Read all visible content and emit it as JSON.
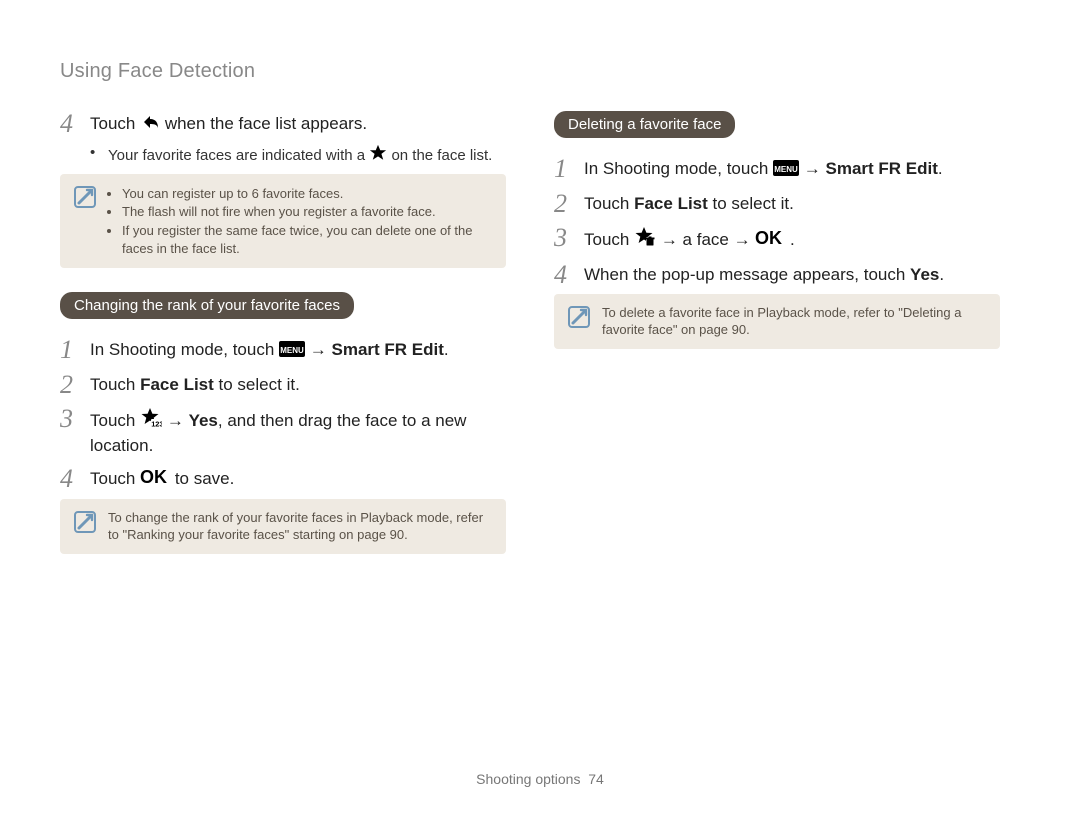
{
  "header": {
    "title": "Using Face Detection"
  },
  "left": {
    "step4": {
      "num": "4",
      "pre": "Touch ",
      "post": " when the face list appears."
    },
    "sub_bullet": {
      "pre": "Your favorite faces are indicated with a ",
      "post": " on the face list."
    },
    "note_items": [
      "You can register up to 6 favorite faces.",
      "The flash will not fire when you register a favorite face.",
      "If you register the same face twice, you can delete one of the faces in the face list."
    ],
    "pill": "Changing the rank of your favorite faces",
    "s1": {
      "num": "1",
      "pre": "In Shooting mode, touch ",
      "mid": " → ",
      "post": "Smart FR Edit",
      "post2": "."
    },
    "s2": {
      "num": "2",
      "pre": "Touch ",
      "bold": "Face List",
      "post": " to select it."
    },
    "s3": {
      "num": "3",
      "pre": "Touch ",
      "mid": " → ",
      "bold": "Yes",
      "post": ", and then drag the face to a new location."
    },
    "s4": {
      "num": "4",
      "pre": "Touch ",
      "post": " to save."
    },
    "note2": "To change the rank of your favorite faces in Playback mode, refer to \"Ranking your favorite faces\" starting on page 90."
  },
  "right": {
    "pill": "Deleting a favorite face",
    "s1": {
      "num": "1",
      "pre": "In Shooting mode, touch ",
      "mid": " → ",
      "post": "Smart FR Edit",
      "post2": "."
    },
    "s2": {
      "num": "2",
      "pre": "Touch ",
      "bold": "Face List",
      "post": " to select it."
    },
    "s3": {
      "num": "3",
      "pre": "Touch ",
      "mid1": " → a face → ",
      "post": "."
    },
    "s4": {
      "num": "4",
      "text_pre": "When the pop-up message appears, touch ",
      "bold": "Yes",
      "post": "."
    },
    "note": "To delete a favorite face in Playback mode, refer to \"Deleting a favorite face\" on page 90."
  },
  "footer": {
    "section": "Shooting options",
    "page": "74"
  }
}
